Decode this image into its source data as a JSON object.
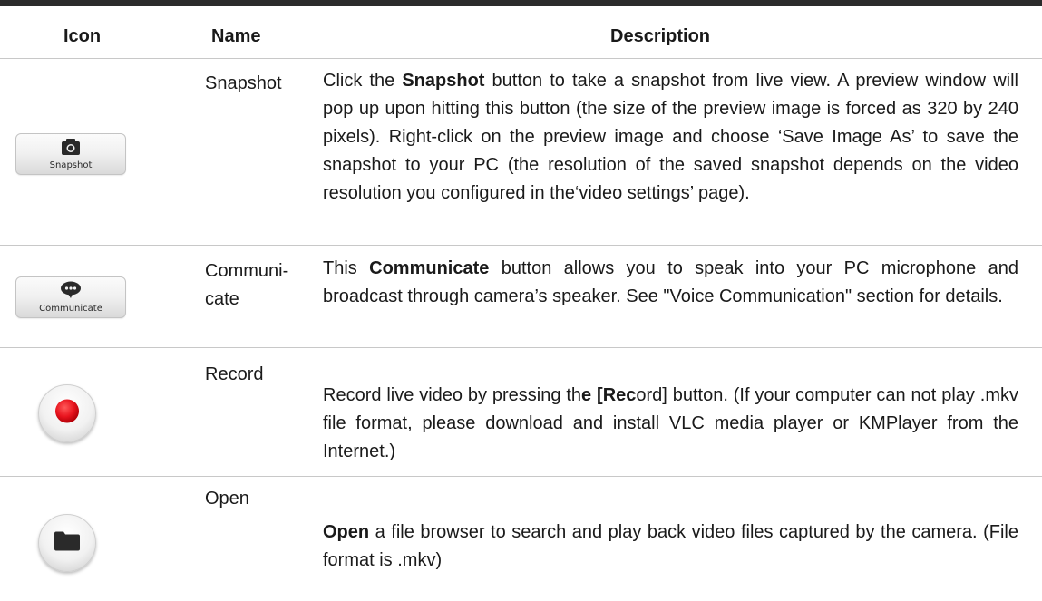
{
  "table": {
    "headers": {
      "icon": "Icon",
      "name": "Name",
      "description": "Description"
    },
    "rows": [
      {
        "icon": "camera-icon",
        "icon_caption": "Snapshot",
        "name": "Snapshot",
        "desc_pre": "Click the ",
        "desc_bold": "Snapshot",
        "desc_post": " button to take a snapshot from live view. A preview window will pop up upon hitting this button (the size of the preview image is forced as 320 by 240 pixels). Right-click on the preview image and choose ‘Save Image As’ to save the snapshot to your PC (the resolution of the saved snapshot depends on the video resolution you configured in the‘video settings’ page)."
      },
      {
        "icon": "speech-bubble-icon",
        "icon_caption": "Communicate",
        "name": "Communi-cate",
        "desc_pre": "This ",
        "desc_bold": "Communicate",
        "desc_post": " button allows you to speak into your PC microphone and broadcast through camera’s speaker. See \"Voice Communication\" section for details."
      },
      {
        "icon": "record-icon",
        "name": "Record",
        "desc_pre": "Record live video by pressing th",
        "desc_bold": "e [Rec",
        "desc_post": "ord] button. (If your computer can not play .mkv file format, please download and install VLC media player or KMPlayer from the Internet.)"
      },
      {
        "icon": "folder-icon",
        "name": "Open",
        "desc_pre": "",
        "desc_bold": "Open",
        "desc_post": " a file browser to search and play back video files captured by the camera. (File format is .mkv)"
      }
    ]
  },
  "colors": {
    "rule": "#2b2b2b",
    "divider": "#c8c8c8",
    "record": "#e8141e",
    "glyph": "#2a2a2a"
  }
}
